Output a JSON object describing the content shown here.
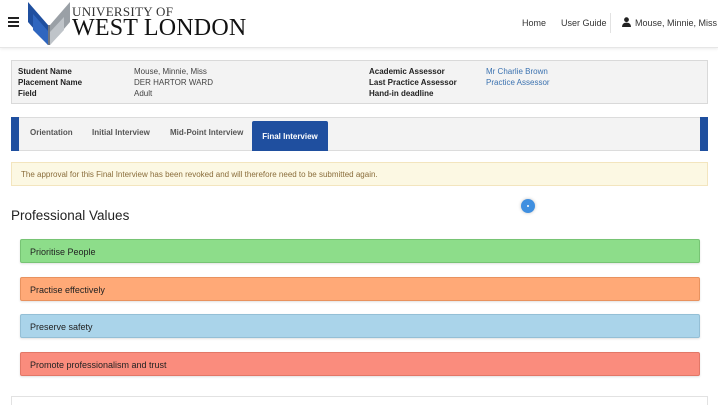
{
  "header": {
    "brand_top": "UNIVERSITY OF",
    "brand_main": "WEST LONDON",
    "nav": {
      "home": "Home",
      "user_guide": "User Guide",
      "user_name": "Mouse, Minnie, Miss"
    }
  },
  "info": {
    "student_name_label": "Student Name",
    "student_name": "Mouse, Minnie, Miss",
    "placement_name_label": "Placement Name",
    "placement_name": "DER HARTOR WARD",
    "field_label": "Field",
    "field": "Adult",
    "academic_assessor_label": "Academic Assessor",
    "academic_assessor": "Mr Charlie Brown",
    "last_practice_assessor_label": "Last Practice Assessor",
    "last_practice_assessor": "Practice Assessor",
    "hand_in_deadline_label": "Hand-in deadline"
  },
  "tabs": {
    "orientation": "Orientation",
    "initial_interview": "Initial Interview",
    "mid_point_interview": "Mid-Point Interview",
    "final_interview": "Final Interview"
  },
  "alert": {
    "text": "The approval for this Final Interview has been revoked and will therefore need to be submitted again."
  },
  "section": {
    "title": "Professional Values"
  },
  "values": {
    "v1": {
      "label": "Prioritise People",
      "color": "#8ddd8a",
      "border": "#77c474"
    },
    "v2": {
      "label": "Practise effectively",
      "color": "#ffa977",
      "border": "#e8925f"
    },
    "v3": {
      "label": "Preserve safety",
      "color": "#aad4ea",
      "border": "#94bfd6"
    },
    "v4": {
      "label": "Promote professionalism and trust",
      "color": "#fa8c7d",
      "border": "#e27767"
    }
  },
  "colors": {
    "brand_blue": "#1f4f9f",
    "link": "#3b72b0",
    "alert_bg": "#fcf8e3",
    "alert_text": "#8a6d3b",
    "loader": "#3f8fe0"
  },
  "icons": {
    "menu": "hamburger-icon",
    "user": "user-icon",
    "logo": "university-logo",
    "loading": "loading-indicator"
  }
}
